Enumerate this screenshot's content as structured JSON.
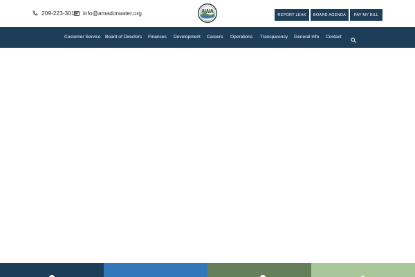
{
  "topbar": {
    "phone": "209-223-3018",
    "email": "info@amadorwater.org",
    "logo_text": "AWA",
    "buttons": {
      "report_leak": "REPORT LEAK",
      "board_agenda": "BOARD AGENDA",
      "pay_bill": "PAY MY BILL"
    }
  },
  "nav": {
    "items": [
      "Customer Service",
      "Board of Directors",
      "Finances",
      "Development",
      "Careers",
      "Operations",
      "Transparency",
      "General Info",
      "Contact"
    ]
  },
  "icons": {
    "phone": "phone-icon",
    "email": "envelope-icon",
    "search": "search-icon"
  },
  "colors": {
    "nav_bg": "#1e3d59",
    "button_bg": "#1f3e5a",
    "tile_1": "#1e3d59",
    "tile_2": "#3377bb",
    "tile_3": "#677e5a",
    "tile_4": "#a8c79a"
  }
}
